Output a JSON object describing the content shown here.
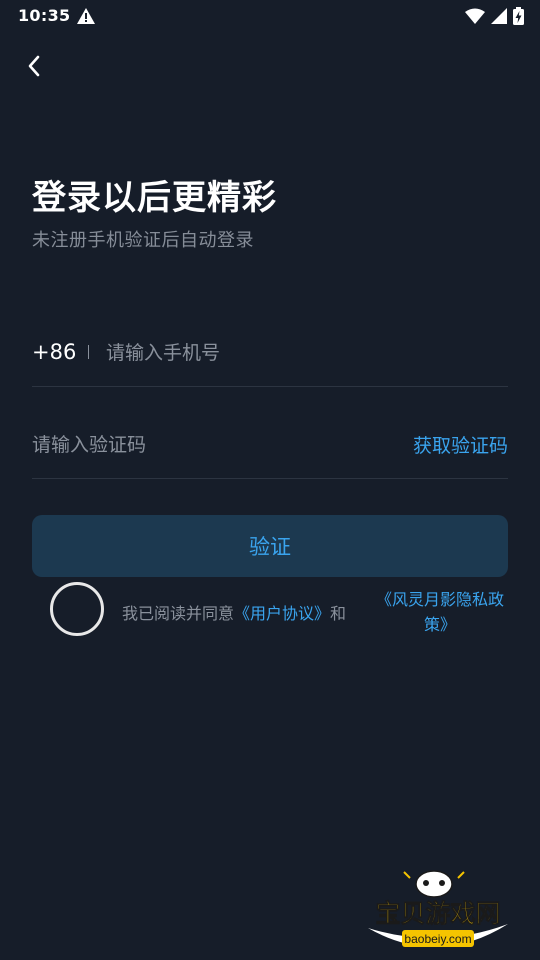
{
  "status_bar": {
    "time": "10:35"
  },
  "header": {
    "title": "登录以后更精彩",
    "subtitle": "未注册手机验证后自动登录"
  },
  "phone": {
    "country_code": "+86",
    "placeholder": "请输入手机号",
    "value": ""
  },
  "code": {
    "placeholder": "请输入验证码",
    "value": "",
    "get_code_label": "获取验证码"
  },
  "verify_button": {
    "label": "验证"
  },
  "agreement": {
    "prefix": "我已阅读并同意",
    "user_agreement": "《用户协议》",
    "conjunction": "和",
    "privacy_policy": "《风灵月影隐私政策》",
    "checked": false
  },
  "watermark": {
    "brand": "宝贝游戏网",
    "domain": "baobeiy.com"
  },
  "colors": {
    "background": "#161d29",
    "accent": "#3aa4ee",
    "button_bg": "#1c3950",
    "muted_text": "#8a919c",
    "divider": "#2c3441"
  }
}
